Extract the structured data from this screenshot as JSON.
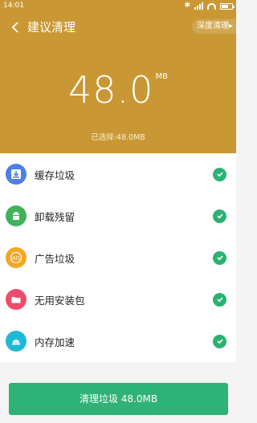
{
  "status_bar": {
    "time": "14:01",
    "battery_level": 0.55
  },
  "header": {
    "title": "建议清理",
    "deep_clean_label": "深度清理",
    "size_value": "48.0",
    "size_unit": "MB",
    "selected_text": "已选择:48.0MB",
    "color": "#c99834"
  },
  "items": [
    {
      "label": "缓存垃圾",
      "icon": "cache-icon",
      "color": "#4d7fe6",
      "checked": true
    },
    {
      "label": "卸载残留",
      "icon": "android-icon",
      "color": "#3fb25a",
      "checked": true
    },
    {
      "label": "广告垃圾",
      "icon": "ad-icon",
      "color": "#f5a623",
      "checked": true
    },
    {
      "label": "无用安装包",
      "icon": "folder-icon",
      "color": "#ee4d6a",
      "checked": true
    },
    {
      "label": "内存加速",
      "icon": "memory-icon",
      "color": "#1fb9d8",
      "checked": true
    }
  ],
  "clean_button_label": "清理垃圾 48.0MB",
  "accent_color": "#2eb275"
}
